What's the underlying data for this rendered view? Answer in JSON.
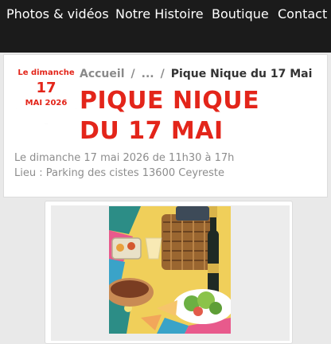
{
  "nav": {
    "items": [
      "Photos & vidéos",
      "Notre Histoire",
      "Boutique",
      "Contact"
    ]
  },
  "date_badge": {
    "top": "Le dimanche",
    "day": "17",
    "bottom": "MAI 2026"
  },
  "breadcrumb": {
    "home": "Accueil",
    "sep1": "/",
    "ellipsis": "...",
    "sep2": "/",
    "current": "Pique Nique du 17 Mai"
  },
  "event": {
    "title_line1": "PIQUE NIQUE",
    "title_line2": "DU 17 MAI",
    "schedule": "Le dimanche 17 mai 2026 de 11h30 à 17h",
    "location": "Lieu : Parking des cistes 13600 Ceyreste"
  },
  "colors": {
    "accent": "#e3251a",
    "nav_bg": "#1b1b1b",
    "page_bg": "#e9e9e9"
  }
}
